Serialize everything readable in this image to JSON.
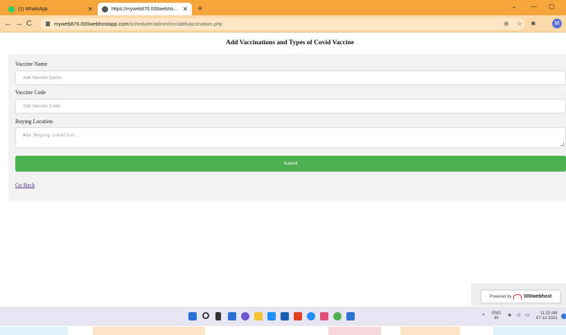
{
  "browser": {
    "tabs": [
      {
        "title": "(1) WhatsApp",
        "favicon_color": "#25d366"
      },
      {
        "title": "https://myweb876.000webhostapp.com/scheduler/admin/inc/addvaccination.php",
        "favicon_color": "#555555"
      }
    ],
    "url_host": "myweb876.000webhostapp.com",
    "url_path": "/scheduler/admin/inc/addvaccination.php",
    "profile_initial": "M"
  },
  "page": {
    "title": "Add Vaccinations and Types of Covid Vaccine"
  },
  "form": {
    "vaccine_name": {
      "label": "Vaccine Name",
      "placeholder": "Add Vaccine Name.."
    },
    "vaccine_code": {
      "label": "Vaccine Code",
      "placeholder": "Add Vaccine Code.."
    },
    "buying_location": {
      "label": "Buying Location",
      "placeholder": "Add Buying Location.."
    },
    "submit_label": "Submit",
    "go_back_label": "Go Back"
  },
  "footer_badge": {
    "powered_by": "Powered by",
    "brand": "000webhost"
  },
  "taskbar": {
    "lang_top": "ENG",
    "lang_bottom": "IN",
    "time": "11:22 AM",
    "date": "07-12-2021"
  },
  "colors": {
    "tabbar": "#f6a43c",
    "submit_green": "#4caf50",
    "panel_bg": "#f2f2f2",
    "link": "#4a2a8a"
  }
}
